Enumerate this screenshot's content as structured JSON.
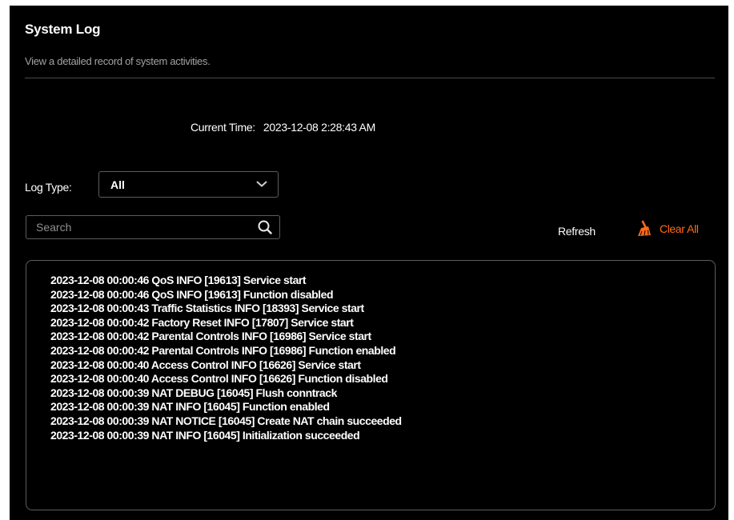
{
  "header": {
    "title": "System Log",
    "subtitle": "View a detailed record of system activities."
  },
  "current_time": {
    "label": "Current Time:",
    "value": "2023-12-08 2:28:43 AM"
  },
  "log_type": {
    "label": "Log Type:",
    "selected": "All"
  },
  "search": {
    "placeholder": "Search",
    "value": ""
  },
  "actions": {
    "refresh_label": "Refresh",
    "clear_all_label": "Clear All"
  },
  "colors": {
    "accent": "#ff6a1a",
    "panel_background": "#000000",
    "border": "#5d5d5d"
  },
  "icons": {
    "dropdown": "chevron-down-icon",
    "search": "search-icon",
    "clear": "broom-icon"
  },
  "log_entries": [
    "2023-12-08 00:00:46 QoS INFO [19613] Service start",
    "2023-12-08 00:00:46 QoS INFO [19613] Function disabled",
    "2023-12-08 00:00:43 Traffic Statistics INFO [18393] Service start",
    "2023-12-08 00:00:42 Factory Reset INFO [17807] Service start",
    "2023-12-08 00:00:42 Parental Controls INFO [16986] Service start",
    "2023-12-08 00:00:42 Parental Controls INFO [16986] Function enabled",
    "2023-12-08 00:00:40 Access Control INFO [16626] Service start",
    "2023-12-08 00:00:40 Access Control INFO [16626] Function disabled",
    "2023-12-08 00:00:39 NAT DEBUG [16045] Flush conntrack",
    "2023-12-08 00:00:39 NAT INFO [16045] Function enabled",
    "2023-12-08 00:00:39 NAT NOTICE [16045] Create NAT chain succeeded",
    "2023-12-08 00:00:39 NAT INFO [16045] Initialization succeeded"
  ]
}
